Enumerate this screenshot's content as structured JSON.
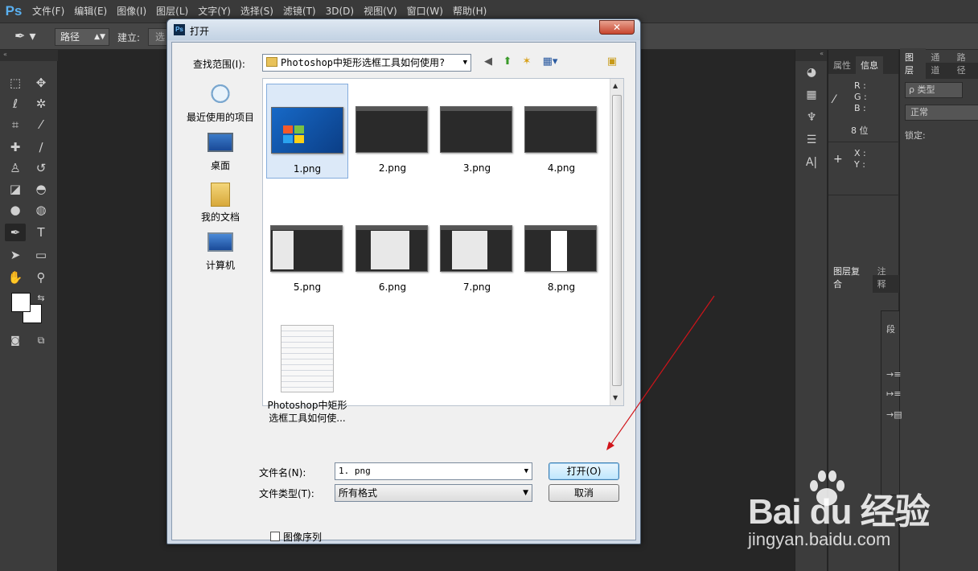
{
  "app": {
    "logo": "Ps"
  },
  "menu": [
    "文件(F)",
    "编辑(E)",
    "图像(I)",
    "图层(L)",
    "文字(Y)",
    "选择(S)",
    "滤镜(T)",
    "3D(D)",
    "视图(V)",
    "窗口(W)",
    "帮助(H)"
  ],
  "options": {
    "path_mode": "路径",
    "make_label": "建立:",
    "make_btn": "选"
  },
  "right_panels": {
    "tabs_info": [
      "属性",
      "信息"
    ],
    "info_rgb": [
      "R :",
      "G :",
      "B :"
    ],
    "bit_depth": "8 位",
    "info_xy": [
      "X :",
      "Y :"
    ],
    "comp_tabs": [
      "图层复合",
      "注释"
    ],
    "layer_tabs": [
      "图层",
      "通道",
      "路径"
    ],
    "layer_search": "ρ 类型",
    "blend_mode": "正常",
    "lock_label": "锁定:",
    "para_label": "段"
  },
  "dialog": {
    "title": "打开",
    "look_in_label": "查找范围(I):",
    "look_in_value": "Photoshop中矩形选框工具如何使用?",
    "places": [
      "最近使用的项目",
      "桌面",
      "我的文档",
      "计算机"
    ],
    "files": [
      "1.png",
      "2.png",
      "3.png",
      "4.png",
      "5.png",
      "6.png",
      "7.png",
      "8.png"
    ],
    "folder_item": [
      "Photoshop中矩形",
      "选框工具如何使..."
    ],
    "file_name_label": "文件名(N):",
    "file_name_value": "1. png",
    "file_type_label": "文件类型(T):",
    "file_type_value": "所有格式",
    "open_button": "打开(O)",
    "cancel_button": "取消",
    "sequence_label": "图像序列",
    "sequence_checked": false
  },
  "watermark": {
    "brand": "Bai du 经验",
    "url": "jingyan.baidu.com"
  },
  "colors": {
    "ps_dark": "#262626",
    "panel": "#3c3c3c",
    "annotation_arrow": "#d0141a"
  }
}
